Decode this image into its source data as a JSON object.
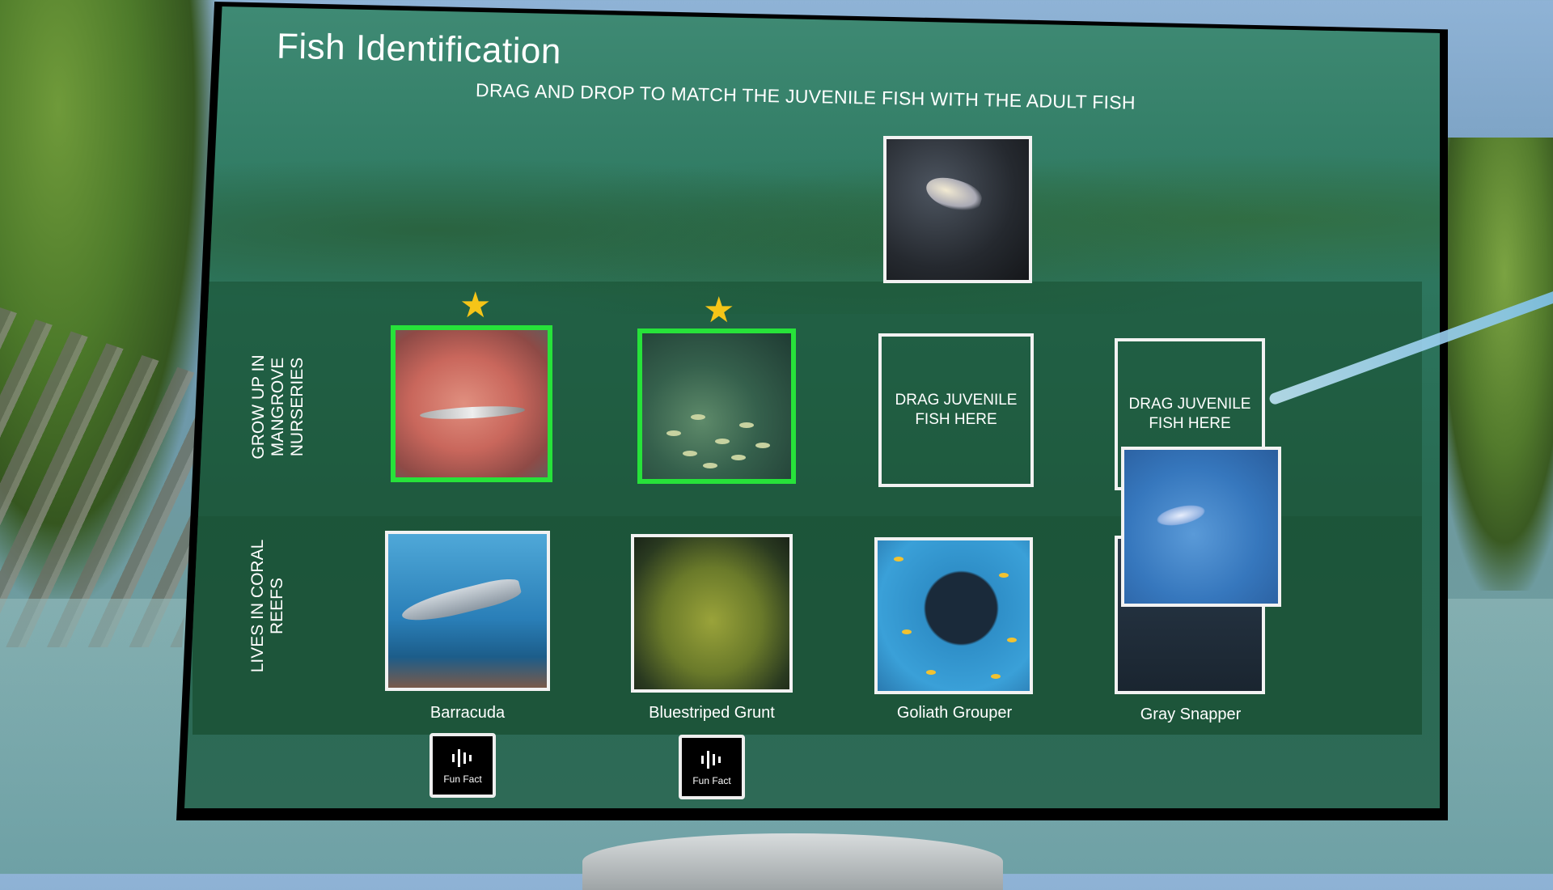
{
  "title": "Fish Identification",
  "instruction": "DRAG AND DROP TO MATCH THE JUVENILE FISH WITH THE ADULT FISH",
  "rows": {
    "mangrove": "GROW UP IN MANGROVE NURSERIES",
    "reef": "LIVES IN CORAL REEFS"
  },
  "drop_zone_text": "DRAG JUVENILE FISH HERE",
  "adults": [
    {
      "name": "Barracuda",
      "matched": true
    },
    {
      "name": "Bluestriped Grunt",
      "matched": true
    },
    {
      "name": "Goliath Grouper",
      "matched": false
    },
    {
      "name": "Gray Snapper",
      "matched": false
    }
  ],
  "fun_fact_label": "Fun Fact",
  "colors": {
    "correct_border": "#27e23a",
    "star": "#f5c518",
    "board": "#2f7a62"
  },
  "icons": {
    "star": "star-icon",
    "audio": "audio-wave-icon"
  }
}
